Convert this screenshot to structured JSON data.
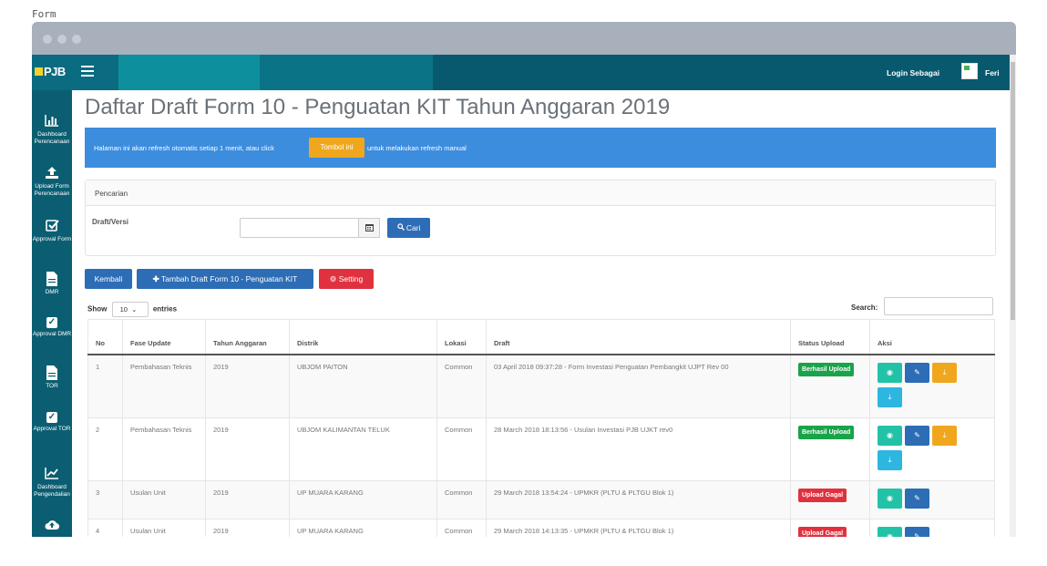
{
  "caption": "Form",
  "header": {
    "logo": "PJB",
    "login_label": "Login Sebagai",
    "username": "Feri"
  },
  "sidebar": {
    "items": [
      {
        "label": "Dashboard Perencanaan",
        "icon": "bar-chart-icon"
      },
      {
        "label": "Upload Form Perencanaan",
        "icon": "upload-icon"
      },
      {
        "label": "Approval Form",
        "icon": "check-square-icon"
      },
      {
        "label": "DMR",
        "icon": "file-icon"
      },
      {
        "label": "Approval DMR",
        "icon": "check-square-icon"
      },
      {
        "label": "TOR",
        "icon": "file-icon"
      },
      {
        "label": "Approval TOR",
        "icon": "check-square-icon"
      },
      {
        "label": "Dashboard Pengendalian",
        "icon": "line-chart-icon"
      },
      {
        "label": "",
        "icon": "cloud-upload-icon"
      }
    ]
  },
  "main": {
    "title": "Daftar Draft Form 10 - Penguatan KIT Tahun Anggaran 2019",
    "info_text_before": "Halaman ini akan refresh otomatis setiap 1 menit, atau click",
    "refresh_button": "Tombol ini",
    "info_text_after": "untuk melakukan refresh manual",
    "search_panel": {
      "heading": "Pencarian",
      "label": "Draft/Versi",
      "input_value": "",
      "search_button": "Cari"
    },
    "buttons": {
      "back": "Kembali",
      "add": "Tambah Draft Form 10 - Penguatan KIT",
      "setting": "Setting"
    },
    "table_controls": {
      "show": "Show",
      "entries_value": "10",
      "entries": "entries",
      "search_label": "Search:"
    },
    "table": {
      "columns": [
        "No",
        "Fase Update",
        "Tahun Anggaran",
        "Distrik",
        "Lokasi",
        "Draft",
        "Status Upload",
        "Aksi"
      ],
      "rows": [
        {
          "no": "1",
          "fase": "Pembahasan Teknis",
          "tahun": "2019",
          "distrik": "UBJOM PAITON",
          "lokasi": "Common",
          "draft": "03 April 2018 09:37:28 - Form Investasi Penguatan Pembangkit UJPT Rev 00",
          "status": "Berhasil Upload"
        },
        {
          "no": "2",
          "fase": "Pembahasan Teknis",
          "tahun": "2019",
          "distrik": "UBJOM KALIMANTAN TELUK",
          "lokasi": "Common",
          "draft": "28 March 2018 18:13:56 - Usulan Investasi PJB UJKT rev0",
          "status": "Berhasil Upload"
        },
        {
          "no": "3",
          "fase": "Usulan Unit",
          "tahun": "2019",
          "distrik": "UP MUARA KARANG",
          "lokasi": "Common",
          "draft": "29 March 2018 13:54:24 - UPMKR (PLTU & PLTGU Blok 1)",
          "status": "Upload Gagal"
        },
        {
          "no": "4",
          "fase": "Usulan Unit",
          "tahun": "2019",
          "distrik": "UP MUARA KARANG",
          "lokasi": "Common",
          "draft": "29 March 2018 14:13:35 - UPMKR (PLTU & PLTGU Blok 1)",
          "status": "Upload Gagal"
        }
      ]
    }
  },
  "colors": {
    "topbar": "#09596e",
    "sidebar": "#0b5e72",
    "info": "#3c8dde",
    "primary": "#2d6db5",
    "warning": "#f0a71e",
    "danger": "#e0323e",
    "success": "#1aa34a"
  }
}
